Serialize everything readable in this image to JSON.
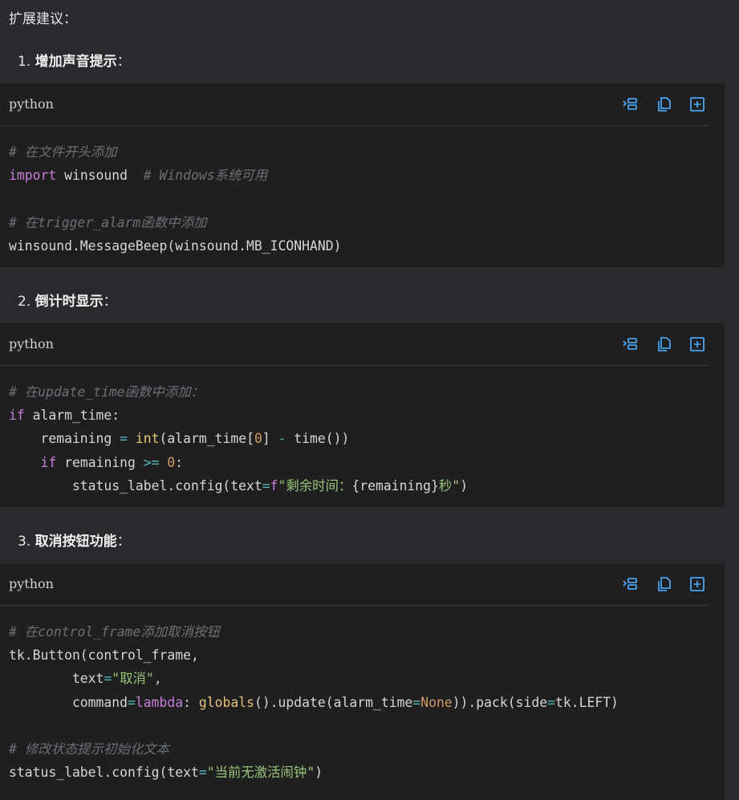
{
  "intro": "扩展建议：",
  "items": [
    {
      "num": "1.",
      "title": "增加声音提示",
      "suffix": "："
    },
    {
      "num": "2.",
      "title": "倒计时显示",
      "suffix": "："
    },
    {
      "num": "3.",
      "title": "取消按钮功能",
      "suffix": "："
    }
  ],
  "blocks": [
    {
      "lang": "python"
    },
    {
      "lang": "python"
    },
    {
      "lang": "python"
    }
  ],
  "code1": {
    "l1": "# 在文件开头添加",
    "l2_kw": "import",
    "l2_rest": " winsound  ",
    "l2_comment": "# Windows系统可用",
    "l4": "# 在trigger_alarm函数中添加",
    "l5": "winsound.MessageBeep(winsound.MB_ICONHAND)"
  },
  "code2": {
    "l1": "# 在update_time函数中添加：",
    "l2_kw": "if",
    "l2_rest": " alarm_time:",
    "l3_a": "    remaining ",
    "l3_eq": "=",
    "l3_sp": " ",
    "l3_int": "int",
    "l3_b": "(alarm_time[",
    "l3_zero": "0",
    "l3_c": "] ",
    "l3_minus": "-",
    "l3_d": " time())",
    "l4_ind": "    ",
    "l4_kw": "if",
    "l4_a": " remaining ",
    "l4_ge": ">=",
    "l4_sp": " ",
    "l4_zero": "0",
    "l4_b": ":",
    "l5_a": "        status_label.config(text",
    "l5_eq": "=",
    "l5_f": "f",
    "l5_s1": "\"剩余时间：",
    "l5_mid": "{remaining}",
    "l5_s2": "秒\"",
    "l5_end": ")"
  },
  "code3": {
    "l1": "# 在control_frame添加取消按钮",
    "l2": "tk.Button(control_frame,",
    "l3_a": "        text",
    "l3_eq": "=",
    "l3_s": "\"取消\"",
    "l3_b": ",",
    "l4_a": "        command",
    "l4_eq": "=",
    "l4_kw": "lambda",
    "l4_b": ": ",
    "l4_g": "globals",
    "l4_c": "().update(alarm_time",
    "l4_eq2": "=",
    "l4_none": "None",
    "l4_d": ")).pack(side",
    "l4_eq3": "=",
    "l4_e": "tk.LEFT)",
    "l6": "# 修改状态提示初始化文本",
    "l7_a": "status_label.config(text",
    "l7_eq": "=",
    "l7_s": "\"当前无激活闹钟\"",
    "l7_b": ")"
  }
}
